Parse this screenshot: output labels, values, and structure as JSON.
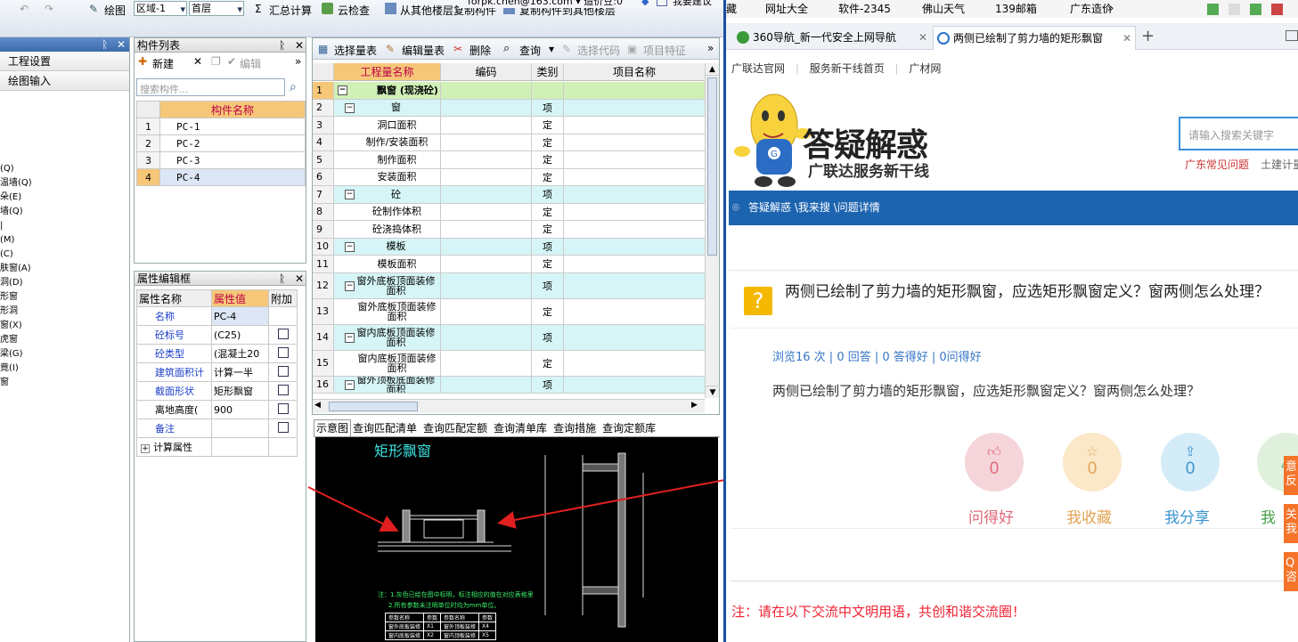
{
  "toolbar": {
    "row1": {
      "draw": "绘图",
      "region": "区域-1",
      "floor": "首层",
      "sum_calc": "汇总计算",
      "cloud_check": "云检查",
      "copy_from": "从其他楼层复制构件",
      "copy_to": "复制构件到其他楼层"
    },
    "top_text": "forpk.chen@163.com ▾  造价豆:0",
    "suggest": "我要建议"
  },
  "left_nav": {
    "title": "",
    "items": [
      "工程设置",
      "绘图输入"
    ],
    "tree": [
      "(Q)",
      "温墙(Q)",
      "朵(E)",
      "墙(Q)",
      "|",
      "(M)",
      "(C)",
      "肤窗(A)",
      "洞(D)",
      "形窗",
      "形洞",
      "窗(X)",
      "虎窗",
      "梁(G)",
      "竟(I)",
      "窗"
    ]
  },
  "component_list": {
    "title": "构件列表",
    "new": "新建",
    "edit": "编辑",
    "search_placeholder": "搜索构件...",
    "header": "构件名称",
    "rows": [
      {
        "n": "1",
        "name": "PC-1"
      },
      {
        "n": "2",
        "name": "PC-2"
      },
      {
        "n": "3",
        "name": "PC-3"
      },
      {
        "n": "4",
        "name": "PC-4"
      }
    ]
  },
  "property_editor": {
    "title": "属性编辑框",
    "headers": [
      "属性名称",
      "属性值",
      "附加"
    ],
    "rows": [
      {
        "name": "名称",
        "value": "PC-4",
        "blue": true,
        "check": false
      },
      {
        "name": "砼标号",
        "value": "(C25)",
        "blue": true,
        "check": true
      },
      {
        "name": "砼类型",
        "value": "(混凝土20",
        "blue": true,
        "check": true
      },
      {
        "name": "建筑面积计",
        "value": "计算一半",
        "blue": true,
        "check": true
      },
      {
        "name": "截面形状",
        "value": "矩形飘窗",
        "blue": true,
        "check": true
      },
      {
        "name": "离地高度(",
        "value": "900",
        "blue": false,
        "check": true
      },
      {
        "name": "备注",
        "value": "",
        "blue": true,
        "check": true
      },
      {
        "name": "计算属性",
        "value": "",
        "blue": false,
        "check": false
      }
    ]
  },
  "qty_table": {
    "toolbar": {
      "select": "选择量表",
      "edit": "编辑量表",
      "delete": "删除",
      "query": "查询",
      "code": "选择代码",
      "feature": "项目特征"
    },
    "headers": [
      "工程量名称",
      "编码",
      "类别",
      "项目名称"
    ],
    "rows": [
      {
        "n": "1",
        "name": "飘窗 (现浇砼)",
        "type": "",
        "level": 0
      },
      {
        "n": "2",
        "name": "窗",
        "type": "项",
        "level": 1
      },
      {
        "n": "3",
        "name": "洞口面积",
        "type": "定",
        "level": 2
      },
      {
        "n": "4",
        "name": "制作/安装面积",
        "type": "定",
        "level": 2
      },
      {
        "n": "5",
        "name": "制作面积",
        "type": "定",
        "level": 2
      },
      {
        "n": "6",
        "name": "安装面积",
        "type": "定",
        "level": 2
      },
      {
        "n": "7",
        "name": "砼",
        "type": "项",
        "level": 1
      },
      {
        "n": "8",
        "name": "砼制作体积",
        "type": "定",
        "level": 2
      },
      {
        "n": "9",
        "name": "砼浇捣体积",
        "type": "定",
        "level": 2
      },
      {
        "n": "10",
        "name": "模板",
        "type": "项",
        "level": 1
      },
      {
        "n": "11",
        "name": "模板面积",
        "type": "定",
        "level": 2
      },
      {
        "n": "12",
        "name": "窗外底板顶面装修面积",
        "type": "项",
        "level": 1
      },
      {
        "n": "13",
        "name": "窗外底板顶面装修面积",
        "type": "定",
        "level": 2
      },
      {
        "n": "14",
        "name": "窗内底板顶面装修面积",
        "type": "项",
        "level": 1
      },
      {
        "n": "15",
        "name": "窗内底板顶面装修面积",
        "type": "定",
        "level": 2
      },
      {
        "n": "16",
        "name": "窗外顶板底面装修面积",
        "type": "项",
        "level": 1
      }
    ]
  },
  "bottom_tabs": [
    "示意图",
    "查询匹配清单",
    "查询匹配定额",
    "查询清单库",
    "查询措施",
    "查询定额库"
  ],
  "diagram": {
    "title": "矩形飘窗",
    "dims": [
      "1800",
      "1800",
      "2800",
      "1500",
      "1800",
      "900",
      "500",
      "800"
    ],
    "labels": [
      "窗长CC",
      "飘入宽",
      "洞口宽DK",
      "洞口高DG",
      "窗高CG",
      "顶板厚B2",
      "底板厚B1"
    ],
    "note1": "注：1.灰色已绘在图中标明，标注相应的值在对应表格里",
    "note2": "2.所有参数未注明单位时均为mm单位。",
    "table_headers": [
      "参数名称",
      "参数",
      "参数名称",
      "参数"
    ],
    "table_rows": [
      [
        "窗外底板装修",
        "X1",
        "窗外顶板装修",
        "X4"
      ],
      [
        "窗内底板装修",
        "X2",
        "窗内顶板装修",
        "X5"
      ]
    ]
  },
  "browser": {
    "bookmarks": [
      "藏",
      "网址大全",
      "软件-2345",
      "佛山天气",
      "139邮箱",
      "广东造价"
    ],
    "tabs": [
      {
        "label": "360导航_新一代安全上网导航"
      },
      {
        "label": "两侧已绘制了剪力墙的矩形飘窗"
      }
    ],
    "site_links": [
      "广联达官网",
      "服务新干线首页",
      "广材网"
    ],
    "brand_title": "答疑解惑",
    "brand_sub": "广联达服务新干线",
    "search_placeholder": "请输入搜索关键字",
    "hot_links": [
      "广东常见问题",
      "土建计量"
    ],
    "breadcrumb": "答疑解惑 \\我来搜 \\问题详情",
    "question_title": "两侧已绘制了剪力墙的矩形飘窗，应选矩形飘窗定义？窗两侧怎么处理？",
    "stats": "浏览16 次 | 0 回答 | 0 答得好 | 0问得好",
    "question_body": "两侧已绘制了剪力墙的矩形飘窗，应选矩形飘窗定义？窗两侧怎么处理？",
    "actions": [
      {
        "count": "0",
        "label": "问得好",
        "color": "#f5d5da",
        "fg": "#e06a7a"
      },
      {
        "count": "0",
        "label": "我收藏",
        "color": "#fbe8c8",
        "fg": "#e1a356"
      },
      {
        "count": "0",
        "label": "我分享",
        "color": "#d3ecf8",
        "fg": "#3b95cf"
      },
      {
        "count": "",
        "label": "我",
        "color": "#dff1dc",
        "fg": "#4aa14a"
      }
    ],
    "side_tabs": [
      "意反",
      "关我",
      "Q咨"
    ],
    "notice": "注：请在以下交流中文明用语，共创和谐交流圈！"
  }
}
